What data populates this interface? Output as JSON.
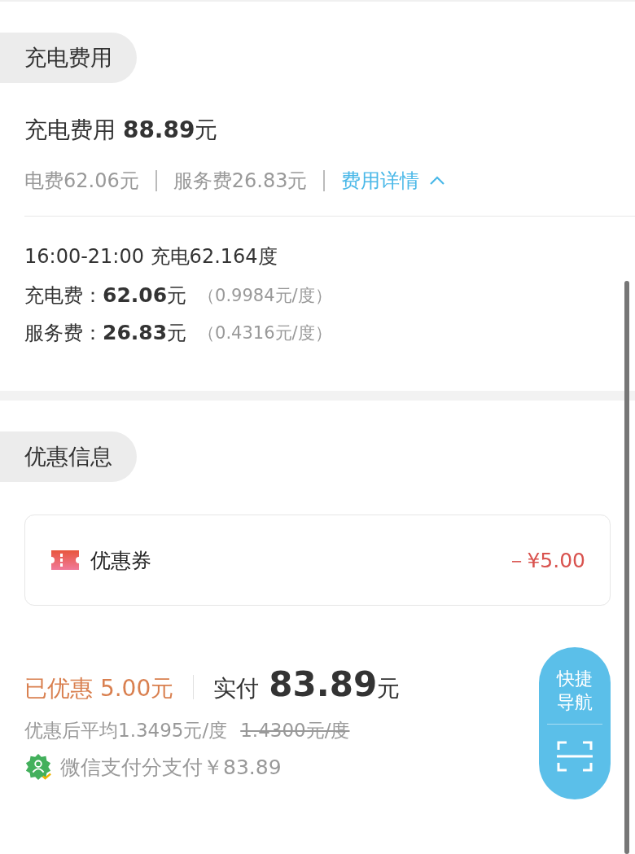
{
  "fee_section": {
    "header": "充电费用",
    "title": "充电费用 **88.89**元",
    "breakdown": [
      "电费62.06元",
      "服务费26.83元"
    ],
    "detail_link": {
      "label": "费用详情",
      "expanded": true
    },
    "period": "16:00-21:00 充电62.164度",
    "rows": [
      {
        "text": "充电费：**62.06**元",
        "unit_price": "（0.9984元/度）"
      },
      {
        "text": "服务费：**26.83**元",
        "unit_price": "（0.4316元/度）"
      }
    ]
  },
  "discount_section": {
    "header": "优惠信息",
    "coupon": {
      "label": "优惠券",
      "amount": "－¥5.00"
    }
  },
  "summary": {
    "saved": "已优惠 5.00元",
    "paid_label": "实付",
    "paid_amount": "83.89",
    "paid_unit": "元",
    "average": "优惠后平均1.3495元/度",
    "original_average": "1.4300元/度",
    "payment": "微信支付分支付￥83.89"
  },
  "float_nav": {
    "label": "快捷导航"
  }
}
